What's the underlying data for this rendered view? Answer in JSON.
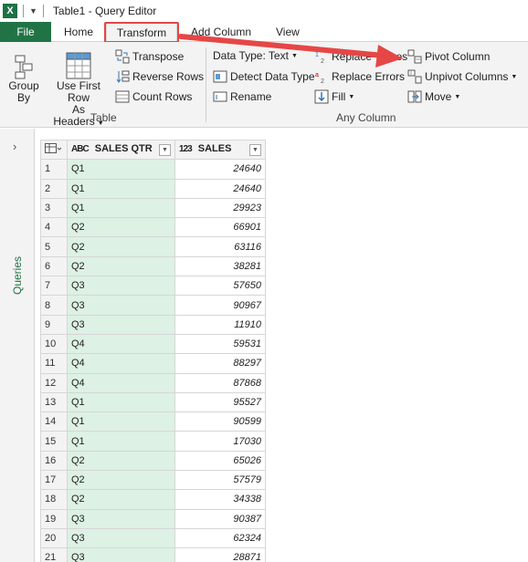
{
  "window": {
    "title": "Table1 - Query Editor",
    "app_icon": "excel-icon"
  },
  "tabs": {
    "file": "File",
    "items": [
      {
        "label": "Home"
      },
      {
        "label": "Transform",
        "active": true
      },
      {
        "label": "Add Column"
      },
      {
        "label": "View"
      }
    ]
  },
  "ribbon": {
    "table_group": {
      "label": "Table",
      "group_by": [
        "Group",
        "By"
      ],
      "use_first_row": [
        "Use First Row",
        "As Headers"
      ],
      "transpose": "Transpose",
      "reverse_rows": "Reverse Rows",
      "count_rows": "Count Rows"
    },
    "any_column_group": {
      "label": "Any Column",
      "data_type": "Data Type: Text",
      "detect_data_type": "Detect Data Type",
      "rename": "Rename",
      "replace_values": "Replace Values",
      "replace_errors": "Replace Errors",
      "fill": "Fill",
      "pivot_column": "Pivot Column",
      "unpivot_columns": "Unpivot Columns",
      "move": "Move"
    }
  },
  "queries_pane": {
    "label": "Queries"
  },
  "grid": {
    "columns": [
      {
        "type_icon": "ABC",
        "name": "SALES QTR"
      },
      {
        "type_icon": "123",
        "name": "SALES"
      }
    ],
    "rows": [
      [
        "1",
        "Q1",
        "24640"
      ],
      [
        "2",
        "Q1",
        "24640"
      ],
      [
        "3",
        "Q1",
        "29923"
      ],
      [
        "4",
        "Q2",
        "66901"
      ],
      [
        "5",
        "Q2",
        "63116"
      ],
      [
        "6",
        "Q2",
        "38281"
      ],
      [
        "7",
        "Q3",
        "57650"
      ],
      [
        "8",
        "Q3",
        "90967"
      ],
      [
        "9",
        "Q3",
        "11910"
      ],
      [
        "10",
        "Q4",
        "59531"
      ],
      [
        "11",
        "Q4",
        "88297"
      ],
      [
        "12",
        "Q4",
        "87868"
      ],
      [
        "13",
        "Q1",
        "95527"
      ],
      [
        "14",
        "Q1",
        "90599"
      ],
      [
        "15",
        "Q1",
        "17030"
      ],
      [
        "16",
        "Q2",
        "65026"
      ],
      [
        "17",
        "Q2",
        "57579"
      ],
      [
        "18",
        "Q2",
        "34338"
      ],
      [
        "19",
        "Q3",
        "90387"
      ],
      [
        "20",
        "Q3",
        "62324"
      ],
      [
        "21",
        "Q3",
        "28871"
      ]
    ]
  },
  "colors": {
    "accent": "#217346",
    "highlight": "#e64646",
    "selected_column": "#ddf1e4"
  }
}
